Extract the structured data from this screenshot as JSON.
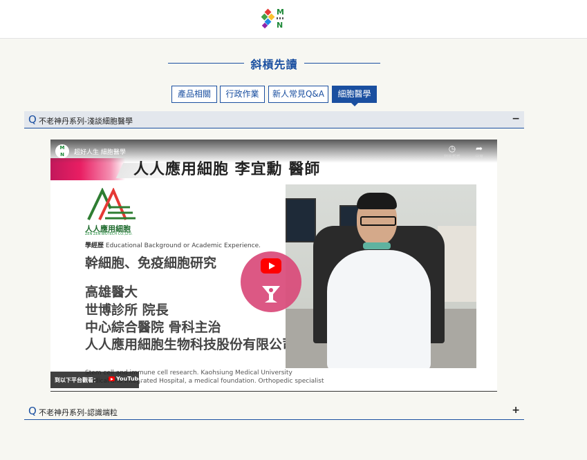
{
  "header": {
    "logo_top": "M",
    "logo_bottom": "N"
  },
  "section": {
    "title": "斜槓先讀"
  },
  "tabs": [
    {
      "label": "產品相關"
    },
    {
      "label": "行政作業"
    },
    {
      "label": "新人常見Q&A"
    },
    {
      "label": "細胞醫學",
      "active": true
    }
  ],
  "faq": [
    {
      "q": "Q",
      "title": "不老神丹系列-淺談細胞醫學",
      "toggle": "−",
      "expanded": true
    },
    {
      "q": "Q",
      "title": "不老神丹系列-認識端粒",
      "toggle": "+",
      "expanded": false
    }
  ],
  "video": {
    "channel_title": "超好人生 細胞醫學",
    "channel_avatar_top": "M",
    "channel_avatar_bottom": "N",
    "watch_later": "稍後觀看",
    "share": "分享",
    "headline": "人人應用細胞  李宜勳 醫師",
    "company_name": "人人應用細胞",
    "company_sub": "ZEN ZEN BIOTECH CO.,LTD.",
    "edu_label_zh": "學經歷",
    "edu_label_en": "Educational Background or Academic Experience.",
    "research": "幹細胞、免疫細胞研究",
    "cv": [
      "高雄醫大",
      "世博診所 院長",
      "中心綜合醫院 骨科主治",
      "人人應用細胞生物科技股份有限公司 董事"
    ],
    "en_lines": [
      "Stem cell and immune cell research. Kaohsiung Medical University",
      "Medical and Integrated Hospital, a medical foundation. Orthopedic specialist"
    ],
    "watch_on_label": "到以下平台觀看：",
    "youtube_word": "YouTube",
    "colors": {
      "accent": "#1a4fa0",
      "play_circle": "#d94a7a",
      "youtube_red": "#ff0000"
    }
  }
}
